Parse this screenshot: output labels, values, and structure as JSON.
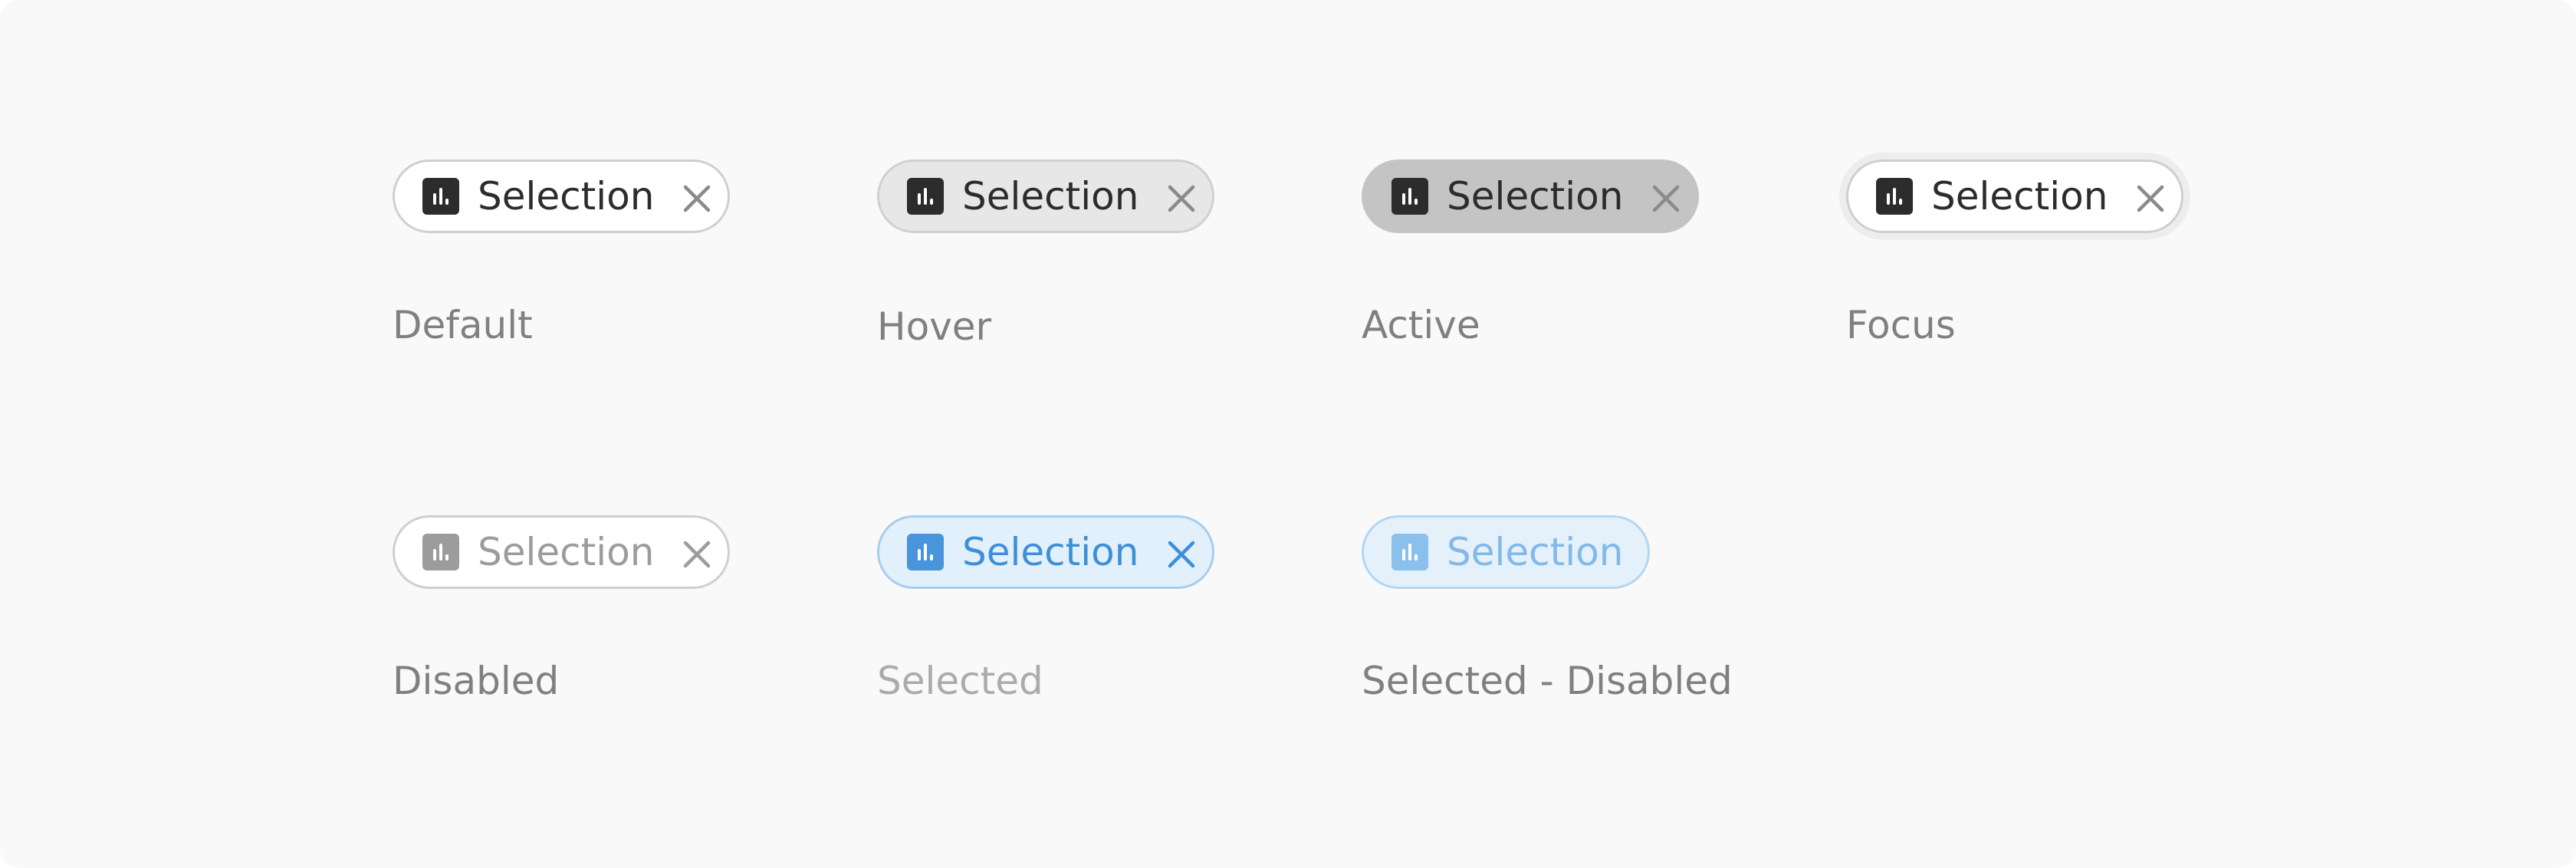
{
  "chips": [
    {
      "state": "default",
      "chip_label": "Selection",
      "state_label": "Default",
      "has_close": true
    },
    {
      "state": "hover",
      "chip_label": "Selection",
      "state_label": "Hover",
      "has_close": true
    },
    {
      "state": "active",
      "chip_label": "Selection",
      "state_label": "Active",
      "has_close": true
    },
    {
      "state": "focus",
      "chip_label": "Selection",
      "state_label": "Focus",
      "has_close": true
    },
    {
      "state": "disabled",
      "chip_label": "Selection",
      "state_label": "Disabled",
      "has_close": true
    },
    {
      "state": "selected",
      "chip_label": "Selection",
      "state_label": "Selected",
      "has_close": true
    },
    {
      "state": "selected-disabled",
      "chip_label": "Selection",
      "state_label": "Selected - Disabled",
      "has_close": false
    }
  ],
  "icons": {
    "chip_icon": "bar-chart-icon",
    "close_icon": "close-icon"
  },
  "colors": {
    "text_default": "#2c2c2c",
    "text_disabled": "#9c9c9c",
    "selected_blue": "#3e8fd8",
    "selected_bg": "#e2f0fb",
    "hover_bg": "#e7e7e7",
    "active_bg": "#c4c4c4",
    "state_label": "#808080"
  }
}
